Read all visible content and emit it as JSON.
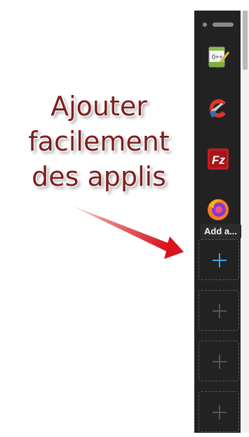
{
  "caption": {
    "lines": [
      "Ajouter",
      "facilement",
      "des applis"
    ]
  },
  "sidebar": {
    "apps": [
      {
        "name": "notepad-plus-plus",
        "icon": "notepad-plus-plus-icon"
      },
      {
        "name": "ccleaner",
        "icon": "ccleaner-icon"
      },
      {
        "name": "filezilla",
        "icon": "filezilla-icon"
      },
      {
        "name": "firefox",
        "icon": "firefox-icon"
      }
    ],
    "add_tooltip": "Add a...",
    "add_slot_icon": "plus-icon",
    "empty_slot_icon": "plus-icon"
  },
  "colors": {
    "panel_bg": "#222222",
    "caption": "#7c1f1f",
    "arrow": "#d9141c",
    "active_plus": "#3aa6ea"
  }
}
